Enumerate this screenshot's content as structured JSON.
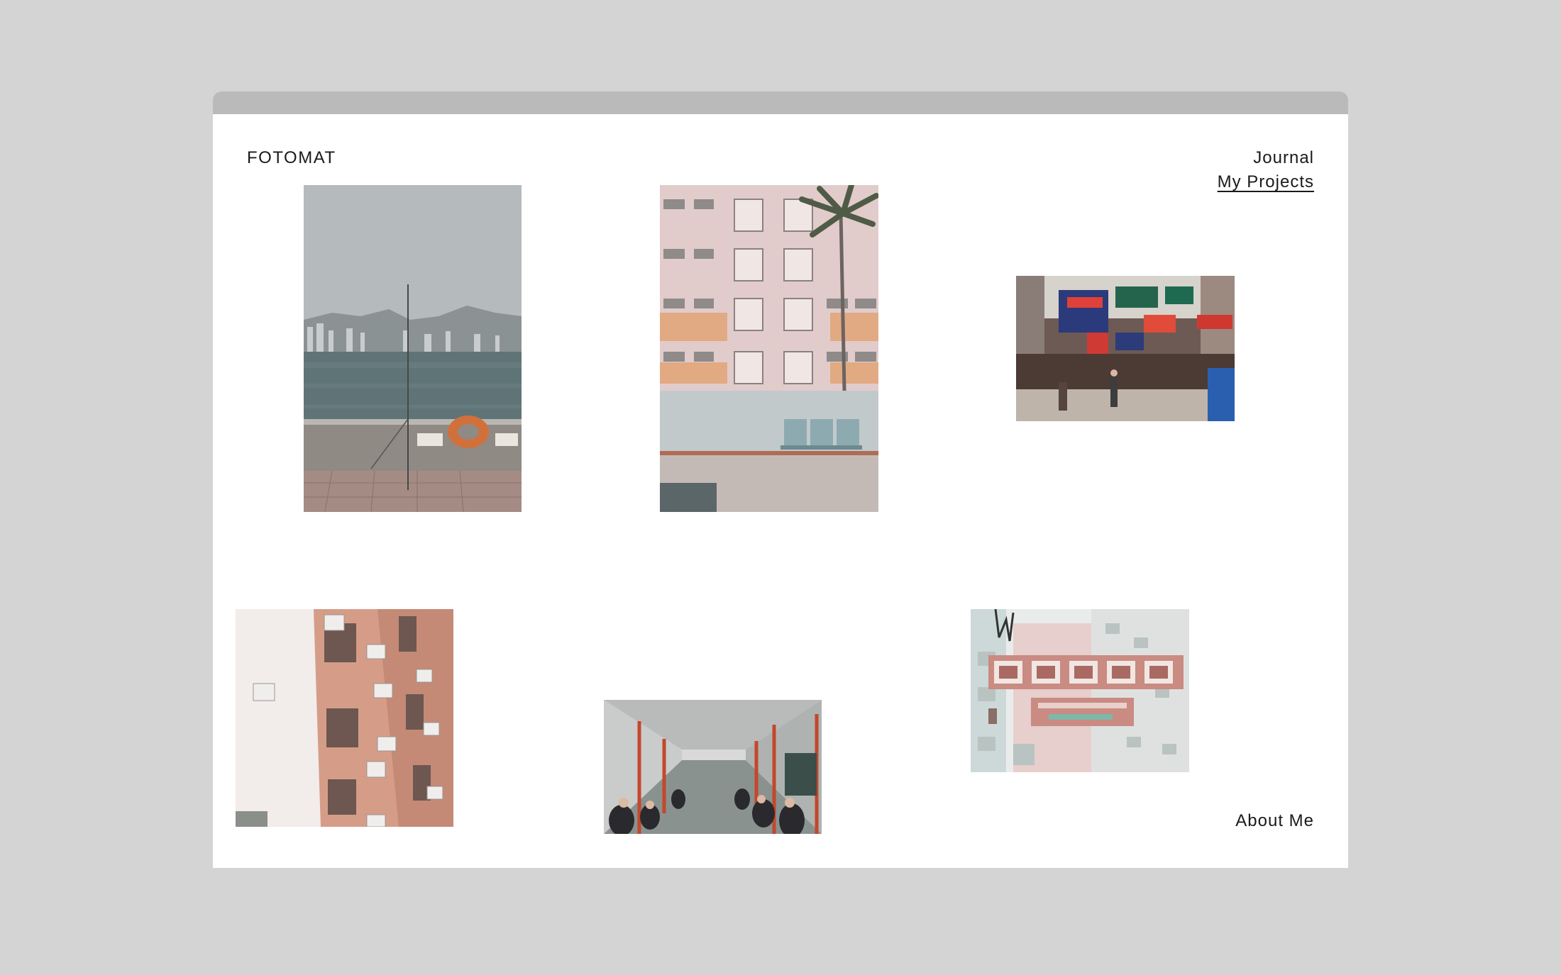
{
  "site": {
    "brand": "FOTOMAT"
  },
  "nav": {
    "journal": "Journal",
    "projects": "My Projects",
    "about": "About Me"
  },
  "gallery": {
    "photos": [
      {
        "id": "harbour",
        "subject": "harbour view with fishing rod and life ring"
      },
      {
        "id": "apartment",
        "subject": "pink apartment block with palm tree and benches"
      },
      {
        "id": "street",
        "subject": "street with neon shop signs"
      },
      {
        "id": "facade",
        "subject": "pink building facade with air conditioners"
      },
      {
        "id": "train",
        "subject": "subway train interior with passengers"
      },
      {
        "id": "signs",
        "subject": "hanging Chinese restaurant sign"
      }
    ]
  },
  "colors": {
    "page_bg": "#d4d4d4",
    "window_bg": "#ffffff",
    "titlebar": "#bababa",
    "text": "#1a1a1a"
  }
}
